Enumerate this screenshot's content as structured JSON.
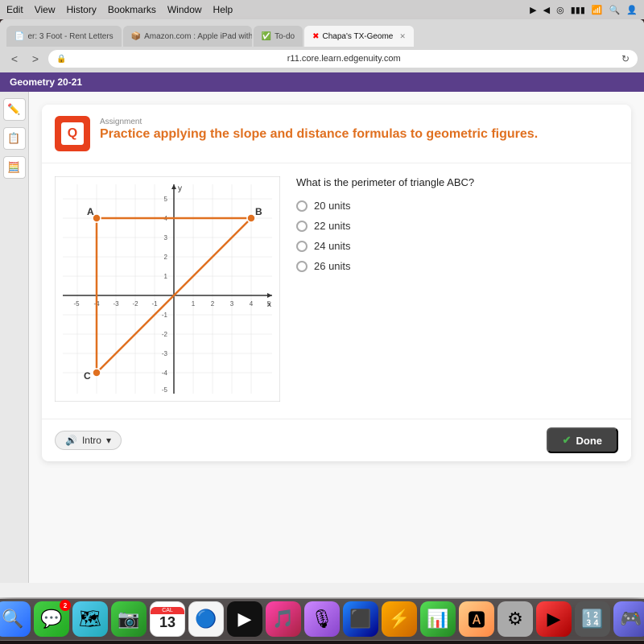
{
  "menu_bar": {
    "items": [
      "Edit",
      "View",
      "History",
      "Bookmarks",
      "Window",
      "Help"
    ],
    "right_icons": [
      "▶",
      "◀",
      "◎",
      "⚡",
      "📶",
      "🔍"
    ]
  },
  "browser": {
    "tabs": [
      {
        "label": "er: 3 Foot - Rent Letters",
        "active": false,
        "favicon": "📄"
      },
      {
        "label": "Amazon.com : Apple iPad with WiFi + Cellular,...",
        "active": false,
        "favicon": "📦"
      },
      {
        "label": "To-do",
        "active": false,
        "favicon": "✅"
      },
      {
        "label": "Chapa's TX-Geome",
        "active": true,
        "favicon": "✖"
      }
    ],
    "address": "r11.core.learn.edgenuity.com",
    "back_label": "<",
    "forward_label": ">",
    "refresh_label": "↻"
  },
  "page": {
    "header": "Geometry 20-21",
    "assignment": {
      "title": "Practice applying the slope and distance formulas to geometric figures.",
      "label": "Assignment",
      "icon_letter": "Q"
    },
    "question": "What is the perimeter of triangle ABC?",
    "options": [
      {
        "value": "20 units",
        "selected": false
      },
      {
        "value": "22 units",
        "selected": false
      },
      {
        "value": "24 units",
        "selected": false
      },
      {
        "value": "26 units",
        "selected": false
      }
    ],
    "graph": {
      "points": {
        "A": {
          "x": -4,
          "y": 4
        },
        "B": {
          "x": 4,
          "y": 4
        },
        "C": {
          "x": -4,
          "y": -4
        }
      }
    },
    "footer": {
      "intro_label": "Intro",
      "done_label": "Done"
    }
  },
  "dock": {
    "icons": [
      {
        "emoji": "🔍",
        "name": "finder"
      },
      {
        "emoji": "📱",
        "name": "messages",
        "badge": "2"
      },
      {
        "emoji": "🗺",
        "name": "maps"
      },
      {
        "emoji": "📷",
        "name": "facetime"
      },
      {
        "emoji": "📅",
        "name": "calendar",
        "number": "13"
      },
      {
        "emoji": "🔵",
        "name": "reminders"
      },
      {
        "emoji": "📺",
        "name": "appletv"
      },
      {
        "emoji": "🎵",
        "name": "music"
      },
      {
        "emoji": "🎙",
        "name": "podcasts"
      },
      {
        "emoji": "⬛",
        "name": "app1"
      },
      {
        "emoji": "⬜",
        "name": "app2"
      },
      {
        "emoji": "📊",
        "name": "numbers"
      },
      {
        "emoji": "🅰",
        "name": "fonts"
      },
      {
        "emoji": "⚙",
        "name": "settings"
      },
      {
        "emoji": "▶",
        "name": "play"
      },
      {
        "emoji": "🔢",
        "name": "calculator"
      },
      {
        "emoji": "🎮",
        "name": "game"
      }
    ]
  }
}
